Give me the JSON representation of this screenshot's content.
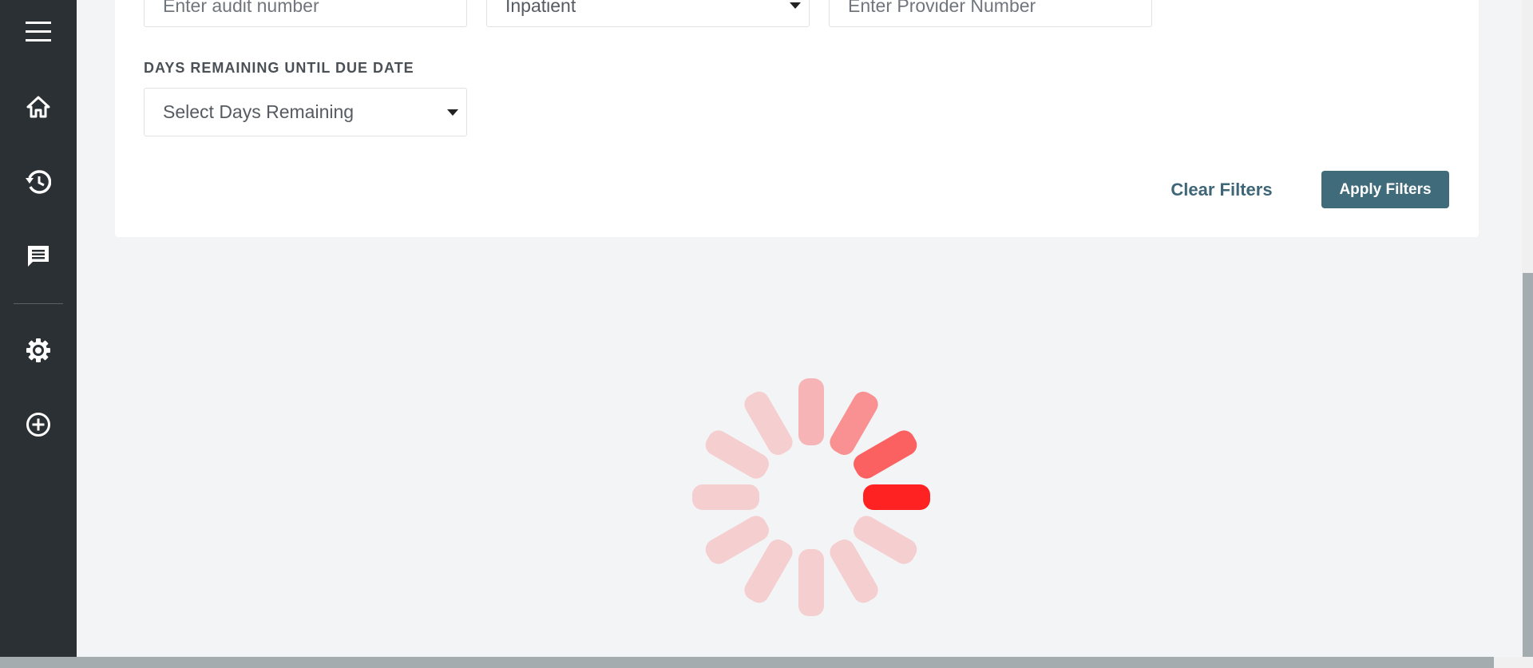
{
  "sidebar": {
    "items": [
      {
        "icon": "menu-icon"
      },
      {
        "icon": "home-icon"
      },
      {
        "icon": "history-icon"
      },
      {
        "icon": "message-icon"
      },
      {
        "icon": "gear-icon"
      },
      {
        "icon": "plus-circle-icon"
      }
    ]
  },
  "filters": {
    "audit_number_placeholder": "Enter audit number",
    "claim_type_value": "Inpatient",
    "provider_number_placeholder": "Enter Provider Number",
    "days_remaining_label": "DAYS REMAINING UNTIL DUE DATE",
    "days_remaining_placeholder": "Select Days Remaining",
    "clear_label": "Clear Filters",
    "apply_label": "Apply Filters"
  },
  "colors": {
    "sidebar_bg": "#2b3034",
    "accent": "#3f6b7a",
    "spinner": "#ff2222"
  }
}
